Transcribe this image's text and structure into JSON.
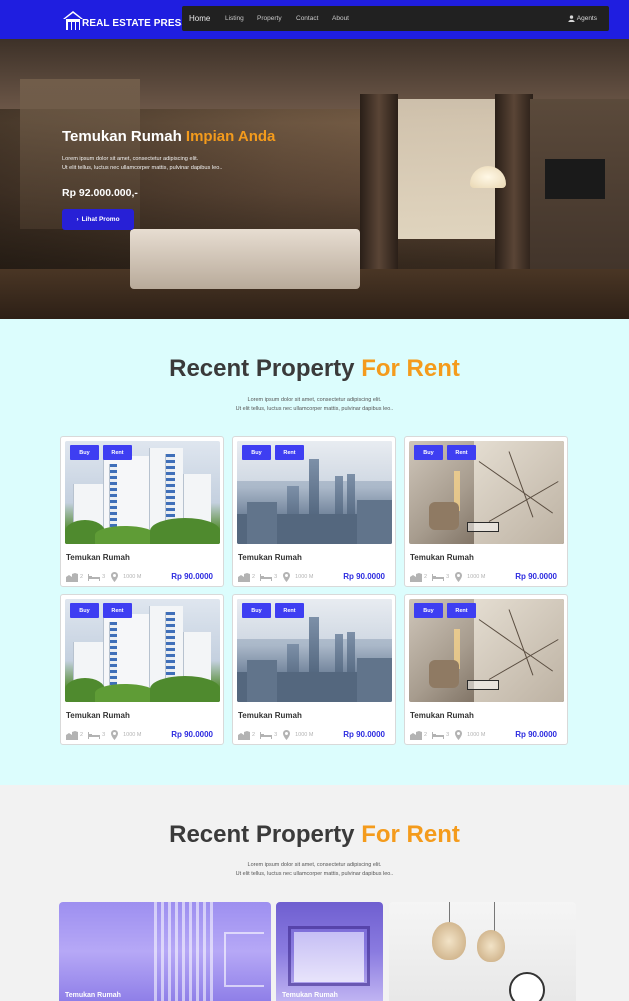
{
  "navbar": {
    "brand": "REAL ESTATE PRESS",
    "items": [
      "Home",
      "Listing",
      "Property",
      "Contact",
      "About"
    ],
    "agents_label": "Agents",
    "colors": {
      "bar": "#1f1ee0",
      "menu": "#212121"
    }
  },
  "hero": {
    "title_main": "Temukan Rumah",
    "title_accent": "Impian Anda",
    "desc_line1": "Lorem ipsum dolor sit amet, consectetur adipiscing elit.",
    "desc_line2": "Ut elit tellus, luctus nec ullamcorper mattis, pulvinar dapibus leo..",
    "price": "Rp 92.000.000,-",
    "button_label": "Lihat Promo"
  },
  "section1": {
    "title_main": "Recent Property",
    "title_accent": "For Rent",
    "sub_line1": "Lorem ipsum dolor sit amet, consectetur adipiscing elit.",
    "sub_line2": "Ut elit tellus, luctus nec ullamcorper mattis, pulvinar dapibus leo..",
    "cards": [
      {
        "image": "apartment-tower",
        "badge_buy": "Buy",
        "badge_rent": "Rent",
        "title": "Temukan Rumah",
        "beds": "2",
        "baths": "3",
        "area": "1000 M",
        "price": "Rp 90.0000"
      },
      {
        "image": "city-skyline",
        "badge_buy": "Buy",
        "badge_rent": "Rent",
        "title": "Temukan Rumah",
        "beds": "2",
        "baths": "3",
        "area": "1000 M",
        "price": "Rp 90.0000"
      },
      {
        "image": "modern-room",
        "badge_buy": "Buy",
        "badge_rent": "Rent",
        "title": "Temukan Rumah",
        "beds": "2",
        "baths": "3",
        "area": "1000 M",
        "price": "Rp 90.0000"
      },
      {
        "image": "apartment-tower",
        "badge_buy": "Buy",
        "badge_rent": "Rent",
        "title": "Temukan Rumah",
        "beds": "2",
        "baths": "3",
        "area": "1000 M",
        "price": "Rp 90.0000"
      },
      {
        "image": "city-skyline",
        "badge_buy": "Buy",
        "badge_rent": "Rent",
        "title": "Temukan Rumah",
        "beds": "2",
        "baths": "3",
        "area": "1000 M",
        "price": "Rp 90.0000"
      },
      {
        "image": "modern-room",
        "badge_buy": "Buy",
        "badge_rent": "Rent",
        "title": "Temukan Rumah",
        "beds": "2",
        "baths": "3",
        "area": "1000 M",
        "price": "Rp 90.0000"
      }
    ]
  },
  "section2": {
    "title_main": "Recent Property",
    "title_accent": "For Rent",
    "sub_line1": "Lorem ipsum dolor sit amet, consectetur adipiscing elit.",
    "sub_line2": "Ut elit tellus, luctus nec ullamcorper mattis, pulvinar dapibus leo..",
    "gallery": [
      {
        "title": "Temukan Rumah"
      },
      {
        "title": "Temukan Rumah"
      },
      {
        "title": ""
      }
    ]
  },
  "accent_color": "#f49b1c",
  "primary_color": "#2d2ce0"
}
